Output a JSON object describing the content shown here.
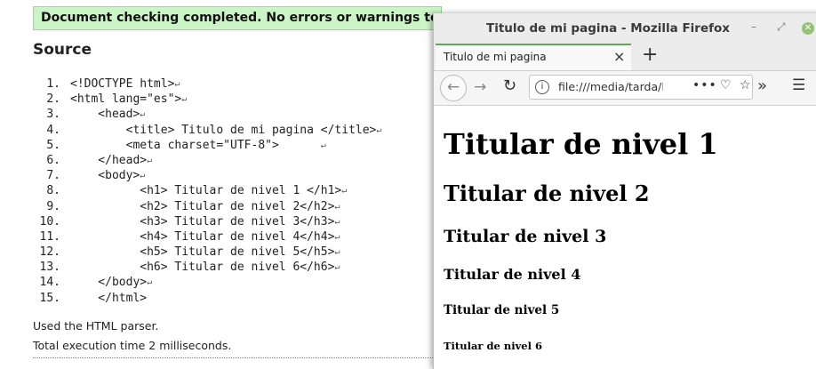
{
  "validator": {
    "banner": "Document checking completed. No errors or warnings to show.",
    "source_title": "Source",
    "lines": [
      {
        "num": "1.",
        "text": "<!DOCTYPE html>"
      },
      {
        "num": "2.",
        "text": "<html lang=\"es\">"
      },
      {
        "num": "3.",
        "text": "    <head>"
      },
      {
        "num": "4.",
        "text": "        <title> Titulo de mi pagina </title>"
      },
      {
        "num": "5.",
        "text": "        <meta charset=\"UTF-8\">      "
      },
      {
        "num": "6.",
        "text": "    </head>"
      },
      {
        "num": "7.",
        "text": "    <body>"
      },
      {
        "num": "8.",
        "text": "          <h1> Titular de nivel 1 </h1>"
      },
      {
        "num": "9.",
        "text": "          <h2> Titular de nivel 2</h2>"
      },
      {
        "num": "10.",
        "text": "          <h3> Titular de nivel 3</h3>"
      },
      {
        "num": "11.",
        "text": "          <h4> Titular de nivel 4</h4>"
      },
      {
        "num": "12.",
        "text": "          <h5> Titular de nivel 5</h5>"
      },
      {
        "num": "13.",
        "text": "          <h6> Titular de nivel 6</h6>"
      },
      {
        "num": "14.",
        "text": "    </body>"
      },
      {
        "num": "15.",
        "text": "    </html>"
      }
    ],
    "eol_symbol": "↵",
    "parser_note": "Used the HTML parser.",
    "timing": "Total execution time 2 milliseconds."
  },
  "firefox": {
    "window_title": "Titulo de mi pagina - Mozilla Firefox",
    "tab_label": "Titulo de mi pagina",
    "url": "file:///media/tarda/D",
    "headings": [
      "Titular de nivel 1",
      "Titular de nivel 2",
      "Titular de nivel 3",
      "Titular de nivel 4",
      "Titular de nivel 5",
      "Titular de nivel 6"
    ]
  },
  "icons": {
    "minimize": "minimize-icon",
    "maximize": "maximize-icon",
    "close": "close-icon",
    "back": "back-arrow-icon",
    "forward": "forward-arrow-icon",
    "reload": "reload-icon",
    "info": "info-icon",
    "more": "more-actions-icon",
    "pocket": "pocket-icon",
    "bookmark": "bookmark-star-icon",
    "overflow": "overflow-chevron-icon",
    "menu": "hamburger-menu-icon"
  },
  "colors": {
    "banner_bg": "#ccf5c7",
    "tab_accent": "#5fa95f",
    "close_button": "#94c276"
  }
}
